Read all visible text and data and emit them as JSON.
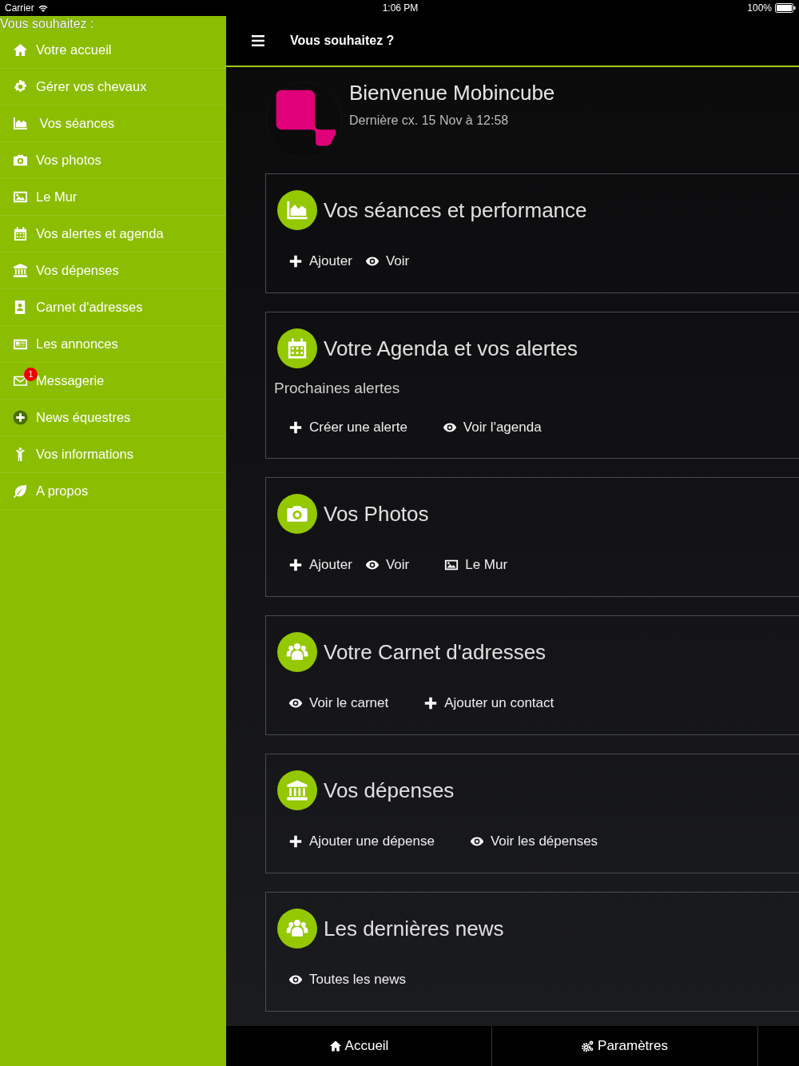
{
  "status_bar": {
    "carrier": "Carrier",
    "time": "1:06 PM",
    "battery": "100%"
  },
  "sidebar": {
    "heading": "Vous souhaitez :",
    "items": [
      {
        "kind": "home",
        "label": "Votre accueil"
      },
      {
        "kind": "gear",
        "label": "Gérer vos chevaux"
      },
      {
        "kind": "chart",
        "label": " Vos séances"
      },
      {
        "kind": "camera",
        "label": "Vos photos"
      },
      {
        "kind": "image",
        "label": "Le Mur"
      },
      {
        "kind": "calendar",
        "label": "Vos alertes et agenda"
      },
      {
        "kind": "bank",
        "label": "Vos dépenses"
      },
      {
        "kind": "contact",
        "label": "Carnet d'adresses"
      },
      {
        "kind": "news",
        "label": "Les annonces"
      },
      {
        "kind": "envelope",
        "label": "Messagerie",
        "badge": "1"
      },
      {
        "kind": "pluscircle",
        "label": "News équestres"
      },
      {
        "kind": "person",
        "label": "Vos informations"
      },
      {
        "kind": "leaf",
        "label": "A propos"
      }
    ]
  },
  "header": {
    "title": "Vous souhaitez ?"
  },
  "profile": {
    "greeting": "Bienvenue  Mobincube",
    "last_login": "Dernière cx. 15 Nov à 12:58"
  },
  "cards": [
    {
      "kind": "chart",
      "title": "Vos séances et performance",
      "actions": [
        {
          "kind": "plus",
          "label": "Ajouter"
        },
        {
          "kind": "eye",
          "label": "Voir"
        }
      ]
    },
    {
      "kind": "calendar",
      "title": "Votre Agenda et vos alertes",
      "subtitle": "Prochaines alertes",
      "actions": [
        {
          "kind": "plus",
          "label": "Créer une alerte"
        },
        {
          "kind": "eye",
          "label": "Voir l'agenda"
        }
      ]
    },
    {
      "kind": "camera",
      "title": "Vos Photos",
      "actions": [
        {
          "kind": "plus",
          "label": "Ajouter"
        },
        {
          "kind": "eye",
          "label": "Voir"
        },
        {
          "kind": "image",
          "label": "Le Mur"
        }
      ]
    },
    {
      "kind": "users",
      "title": "Votre Carnet d'adresses",
      "actions": [
        {
          "kind": "eye",
          "label": "Voir le carnet"
        },
        {
          "kind": "plus",
          "label": "Ajouter un contact"
        }
      ]
    },
    {
      "kind": "bank",
      "title": "Vos dépenses",
      "actions": [
        {
          "kind": "plus",
          "label": "Ajouter une dépense"
        },
        {
          "kind": "eye",
          "label": "Voir les dépenses"
        }
      ]
    },
    {
      "kind": "users",
      "title": "Les dernières news",
      "actions": [
        {
          "kind": "eye",
          "label": "Toutes les news"
        }
      ]
    }
  ],
  "tab_bar": [
    {
      "kind": "home",
      "label": "Accueil"
    },
    {
      "kind": "gears",
      "label": "Paramètres"
    }
  ]
}
